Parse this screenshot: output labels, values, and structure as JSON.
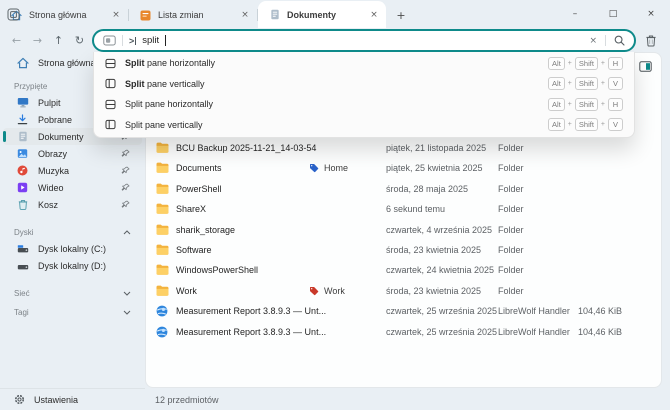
{
  "colors": {
    "accent": "#0e8a8a",
    "tag_home": "#2a62c9",
    "tag_work": "#c9392a",
    "folder_front": "#fdd065",
    "folder_back": "#f3b33e"
  },
  "window": {
    "minimize": "–",
    "maximize": "□",
    "close": "×"
  },
  "tabbar": {
    "tabs": [
      {
        "label": "Strona główna",
        "close": "×"
      },
      {
        "label": "Lista zmian",
        "close": "×"
      },
      {
        "label": "Dokumenty",
        "close": "×"
      }
    ],
    "new_tab": "+"
  },
  "toolbar": {
    "back": "←",
    "forward": "→",
    "up": "↑",
    "refresh": "↻",
    "omnibar": {
      "prompt": ">",
      "query": "split",
      "clear": "×"
    }
  },
  "palette": {
    "items": [
      {
        "match": "Split",
        "rest": " pane horizontally",
        "keys": [
          "Alt",
          "Shift",
          "H"
        ]
      },
      {
        "match": "Split",
        "rest": " pane vertically",
        "keys": [
          "Alt",
          "Shift",
          "V"
        ]
      },
      {
        "match": "",
        "rest": "Split pane horizontally",
        "keys": [
          "Alt",
          "Shift",
          "H"
        ]
      },
      {
        "match": "",
        "rest": "Split pane vertically",
        "keys": [
          "Alt",
          "Shift",
          "V"
        ]
      }
    ],
    "plus": "+"
  },
  "sidebar": {
    "home": {
      "label": "Strona główna"
    },
    "pinned_header": "Przypięte",
    "pinned": [
      {
        "label": "Pulpit"
      },
      {
        "label": "Pobrane"
      },
      {
        "label": "Dokumenty"
      },
      {
        "label": "Obrazy"
      },
      {
        "label": "Muzyka"
      },
      {
        "label": "Wideo"
      },
      {
        "label": "Kosz"
      }
    ],
    "drives_header": "Dyski",
    "drives": [
      {
        "label": "Dysk lokalny (C:)"
      },
      {
        "label": "Dysk lokalny (D:)"
      }
    ],
    "network_header": "Sieć",
    "tags_header": "Tagi",
    "settings": "Ustawienia"
  },
  "filelist": {
    "rows": [
      {
        "name": "BCU Backup 2025-11-21_14-03-54",
        "date": "piątek, 21 listopada 2025",
        "type": "Folder",
        "size": ""
      },
      {
        "name": "Documents",
        "tag": "Home",
        "tag_color": "#2a62c9",
        "date": "piątek, 25 kwietnia 2025",
        "type": "Folder",
        "size": ""
      },
      {
        "name": "PowerShell",
        "date": "środa, 28 maja 2025",
        "type": "Folder",
        "size": ""
      },
      {
        "name": "ShareX",
        "date": "6 sekund temu",
        "type": "Folder",
        "size": ""
      },
      {
        "name": "sharik_storage",
        "date": "czwartek, 4 września 2025",
        "type": "Folder",
        "size": ""
      },
      {
        "name": "Software",
        "date": "środa, 23 kwietnia 2025",
        "type": "Folder",
        "size": ""
      },
      {
        "name": "WindowsPowerShell",
        "date": "czwartek, 24 kwietnia 2025",
        "type": "Folder",
        "size": ""
      },
      {
        "name": "Work",
        "tag": "Work",
        "tag_color": "#c9392a",
        "date": "środa, 23 kwietnia 2025",
        "type": "Folder",
        "size": ""
      },
      {
        "name": "Measurement Report 3.8.9.3 — Unt...",
        "date": "czwartek, 25 września 2025",
        "type": "LibreWolf Handler",
        "size": "104,46 KiB"
      },
      {
        "name": "Measurement Report 3.8.9.3 — Unt...",
        "date": "czwartek, 25 września 2025",
        "type": "LibreWolf Handler",
        "size": "104,46 KiB"
      }
    ]
  },
  "statusbar": {
    "items_count": "12 przedmiotów"
  }
}
